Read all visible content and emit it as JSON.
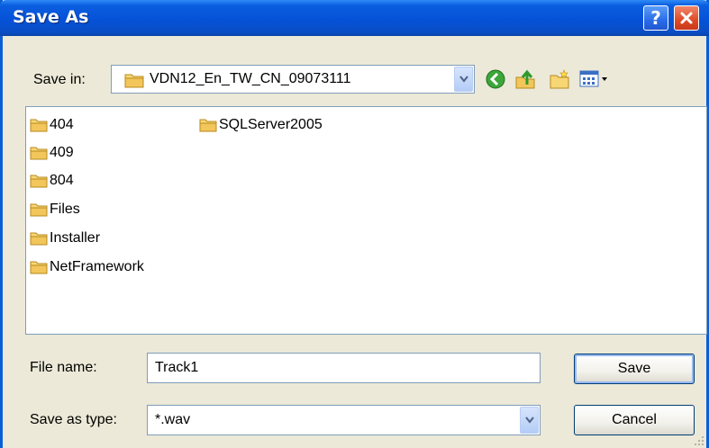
{
  "window": {
    "title": "Save As"
  },
  "title_buttons": {
    "help": "?",
    "close": "X"
  },
  "save_in": {
    "label": "Save in:",
    "value": "VDN12_En_TW_CN_09073111"
  },
  "toolbar": {
    "back_icon": "back-arrow-icon",
    "up_icon": "up-folder-icon",
    "new_folder_icon": "new-folder-icon",
    "views_icon": "views-menu-icon"
  },
  "files": {
    "column1": [
      "404",
      "409",
      "804",
      "Files",
      "Installer",
      "NetFramework"
    ],
    "column2": [
      "SQLServer2005"
    ]
  },
  "file_name": {
    "label": "File name:",
    "value": "Track1"
  },
  "save_as_type": {
    "label": "Save as type:",
    "value": "*.wav"
  },
  "buttons": {
    "save": "Save",
    "cancel": "Cancel"
  },
  "colors": {
    "title_bar": "#0552d8",
    "dialog_bg": "#ece9d8",
    "close_red": "#df4a26",
    "folder_yellow": "#f2c65a"
  }
}
